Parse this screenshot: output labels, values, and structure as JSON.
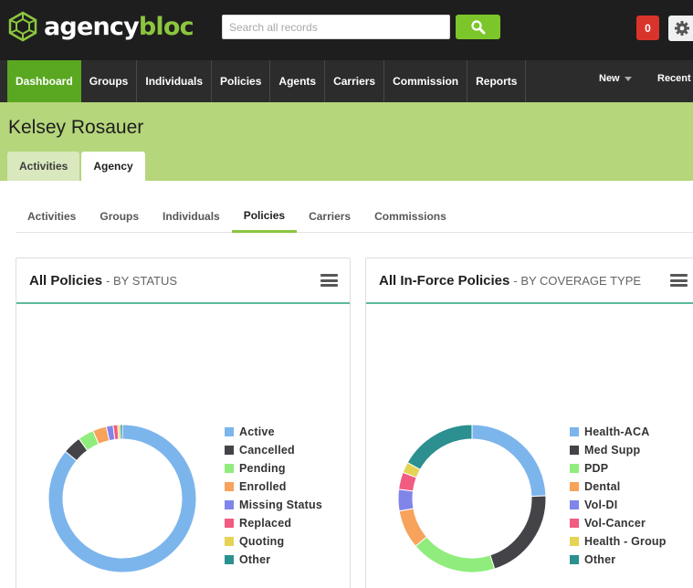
{
  "brand": {
    "name_part1": "agency",
    "name_part2": "bloc",
    "color_primary": "#8cc63f"
  },
  "search": {
    "placeholder": "Search all records",
    "button_icon": "search-icon"
  },
  "notifications": {
    "count": "0"
  },
  "nav": {
    "items": [
      "Dashboard",
      "Groups",
      "Individuals",
      "Policies",
      "Agents",
      "Carriers",
      "Commission",
      "Reports"
    ],
    "active": "Dashboard",
    "new_label": "New",
    "recent_label": "Recent"
  },
  "header": {
    "person_name": "Kelsey Rosauer",
    "tabs": [
      "Activities",
      "Agency"
    ],
    "active_tab": "Agency"
  },
  "subtabs": {
    "items": [
      "Activities",
      "Groups",
      "Individuals",
      "Policies",
      "Carriers",
      "Commissions"
    ],
    "active": "Policies"
  },
  "panels": [
    {
      "title": "All Policies",
      "subtitle": "- BY STATUS",
      "chart_data": {
        "type": "pie",
        "categories": [
          "Active",
          "Cancelled",
          "Pending",
          "Enrolled",
          "Missing Status",
          "Replaced",
          "Quoting",
          "Other"
        ],
        "values": [
          86,
          4,
          3.5,
          3,
          1.5,
          1,
          0.5,
          0.5
        ],
        "colors": [
          "#7cb5ec",
          "#434348",
          "#90ed7d",
          "#f7a35c",
          "#8085e9",
          "#f15c80",
          "#e4d354",
          "#2b908f"
        ],
        "legend": "right"
      }
    },
    {
      "title": "All In-Force Policies",
      "subtitle": "- BY COVERAGE TYPE",
      "chart_data": {
        "type": "pie",
        "categories": [
          "Health-ACA",
          "Med Supp",
          "PDP",
          "Dental",
          "Vol-DI",
          "Vol-Cancer",
          "Health - Group",
          "Other"
        ],
        "values": [
          26,
          22,
          20,
          9,
          5,
          4,
          2.5,
          18
        ],
        "colors": [
          "#7cb5ec",
          "#434348",
          "#90ed7d",
          "#f7a35c",
          "#8085e9",
          "#f15c80",
          "#e4d354",
          "#2b908f"
        ],
        "legend": "right"
      }
    }
  ]
}
